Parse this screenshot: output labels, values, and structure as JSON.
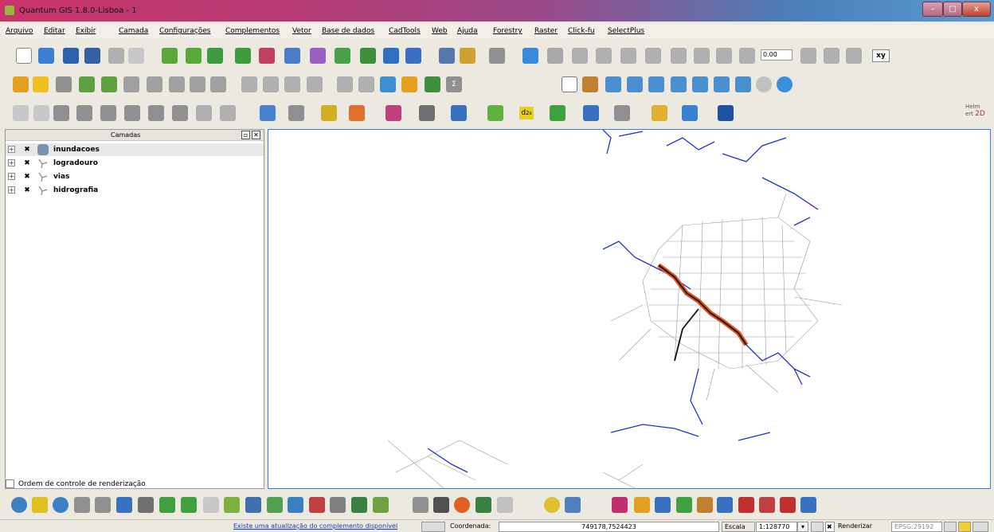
{
  "window": {
    "title": "Quantum GIS 1.8.0-Lisboa - 1",
    "min_glyph": "–",
    "max_glyph": "□",
    "close_glyph": "x"
  },
  "menu": [
    "Arquivo",
    "Editar",
    "Exibir",
    "Camada",
    "Configurações",
    "Complementos",
    "Vetor",
    "Base de dados",
    "CadTools",
    "Web",
    "Ajuda",
    "Forestry",
    "Raster",
    "Click-fu",
    "SelectPlus"
  ],
  "toolbar": {
    "scale_field_value": "0.00",
    "xy_label": "xy",
    "d2_label": "d",
    "d2_sub": "2",
    "d2_subsub": "s",
    "helmert_label": "Helm ert",
    "helmert_2d": "2D",
    "sigma_label": "Σ"
  },
  "layers_panel": {
    "title": "Camadas",
    "float_glyph": "▫",
    "close_glyph": "✕",
    "expand_glyph": "+",
    "check_glyph": "✖",
    "layers": [
      {
        "name": "inundacoes",
        "icon": "polygon-layer-icon"
      },
      {
        "name": "logradouro",
        "icon": "line-layer-icon"
      },
      {
        "name": "vias",
        "icon": "line-layer-icon"
      },
      {
        "name": "hidrografia",
        "icon": "line-layer-icon"
      }
    ],
    "render_order_label": "Ordem de controle de renderização"
  },
  "statusbar": {
    "plugin_update_msg": "Existe uma atualização do complemento disponível",
    "coord_label": "Coordenada:",
    "coord_value": "749178,7524423",
    "scale_label": "Escala",
    "scale_value": "1:128770",
    "render_label": "Renderizar",
    "render_check": "✖",
    "epsg": "EPSG:29192",
    "dropdown_glyph": "▾"
  },
  "colors": {
    "river": "#1f2fd6",
    "flood": "#e2561e",
    "street": "#8a8a8a",
    "main_road": "#111111",
    "map_border": "#3b7de0"
  }
}
